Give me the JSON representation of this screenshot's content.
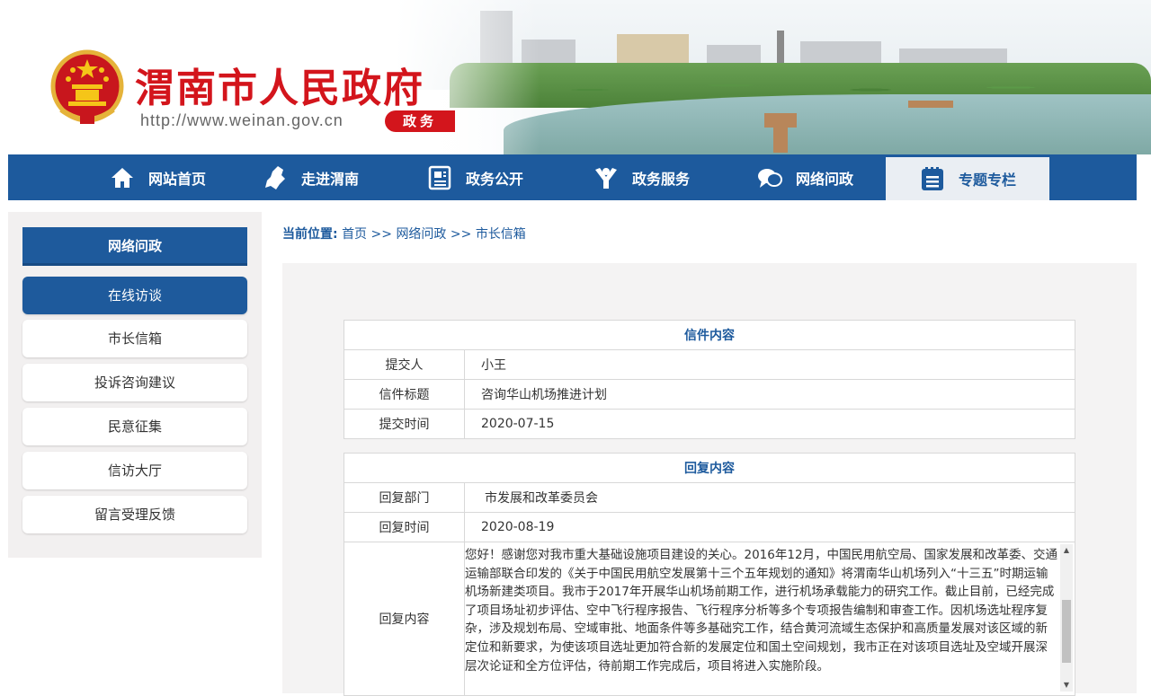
{
  "header": {
    "title": "渭南市人民政府",
    "url": "http://www.weinan.gov.cn",
    "tag": "政务"
  },
  "nav": {
    "items": [
      {
        "label": "网站首页",
        "icon": "home-icon"
      },
      {
        "label": "走进渭南",
        "icon": "map-icon"
      },
      {
        "label": "政务公开",
        "icon": "document-icon"
      },
      {
        "label": "政务服务",
        "icon": "service-icon"
      },
      {
        "label": "网络问政",
        "icon": "chat-icon"
      },
      {
        "label": "专题专栏",
        "icon": "calendar-list-icon"
      }
    ]
  },
  "sidebar": {
    "heading": "网络问政",
    "items": [
      {
        "label": "在线访谈"
      },
      {
        "label": "市长信箱"
      },
      {
        "label": "投诉咨询建议"
      },
      {
        "label": "民意征集"
      },
      {
        "label": "信访大厅"
      },
      {
        "label": "留言受理反馈"
      }
    ]
  },
  "breadcrumb": {
    "prefix": "当前位置:",
    "home": "首页",
    "sep": ">>",
    "section": "网络问政",
    "current": "市长信箱"
  },
  "letter": {
    "heading": "信件内容",
    "submitter_label": "提交人",
    "submitter": "小王",
    "subject_label": "信件标题",
    "subject": "咨询华山机场推进计划",
    "time_label": "提交时间",
    "time": "2020-07-15"
  },
  "reply": {
    "heading": "回复内容",
    "dept_label": "回复部门",
    "dept": "市发展和改革委员会",
    "time_label": "回复时间",
    "time": "2020-08-19",
    "content_label": "回复内容",
    "content": "您好！感谢您对我市重大基础设施项目建设的关心。2016年12月，中国民用航空局、国家发展和改革委、交通运输部联合印发的《关于中国民用航空发展第十三个五年规划的通知》将渭南华山机场列入“十三五”时期运输机场新建类项目。我市于2017年开展华山机场前期工作，进行机场承载能力的研究工作。截止目前，已经完成了项目场址初步评估、空中飞行程序报告、飞行程序分析等多个专项报告编制和审查工作。因机场选址程序复杂，涉及规划布局、空域审批、地面条件等多基础究工作，结合黄河流域生态保护和高质量发展对该区域的新定位和新要求，为使该项目选址更加符合新的发展定位和国土空间规划，我市正在对该项目选址及空域开展深层次论证和全方位评估，待前期工作完成后，项目将进入实施阶段。"
  },
  "colors": {
    "brand_red": "#d3151c",
    "nav_blue": "#1d5a9d"
  }
}
